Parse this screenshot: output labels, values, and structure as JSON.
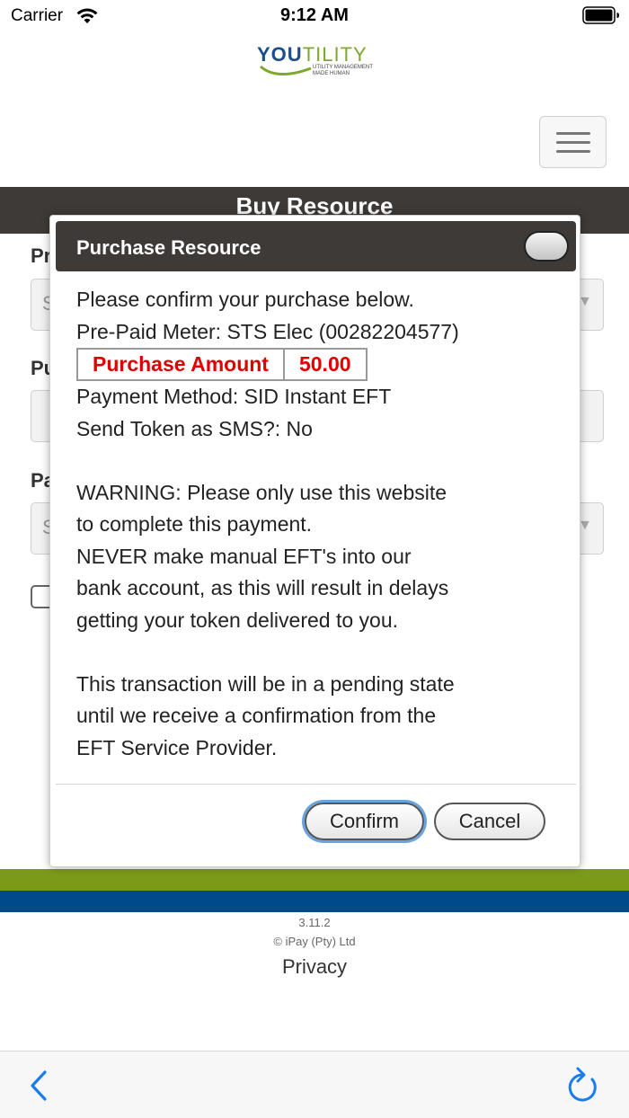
{
  "status_bar": {
    "carrier": "Carrier",
    "time": "9:12 AM"
  },
  "header": {
    "logo_you": "YOU",
    "logo_tility": "TILITY",
    "logo_tag_line1": "UTILITY MANAGEMENT",
    "logo_tag_line2": "MADE HUMAN"
  },
  "page": {
    "title": "Buy Resource",
    "field_label_1": "Pr",
    "field_label_2": "Pu",
    "field_label_3": "Pa",
    "select_placeholder_1": "S",
    "select_placeholder_3": "S"
  },
  "modal": {
    "title": "Purchase Resource",
    "intro": "Please confirm your purchase below.",
    "meter": "Pre-Paid Meter: STS Elec (00282204577)",
    "amount_label": "Purchase Amount",
    "amount_value": "50.00",
    "payment_method": "Payment Method: SID Instant EFT",
    "send_sms": "Send Token as SMS?: No",
    "warning_lines": [
      "WARNING: Please only use this website",
      "to complete this payment.",
      "NEVER make manual EFT's into our",
      "bank account, as this will result in delays",
      "getting your token delivered to you."
    ],
    "pending_lines": [
      "This transaction will be in a pending state",
      "until we receive a confirmation from the",
      "EFT Service Provider."
    ],
    "confirm_label": "Confirm",
    "cancel_label": "Cancel"
  },
  "footer": {
    "version": "3.11.2",
    "copyright": "© iPay (Pty) Ltd",
    "privacy": "Privacy"
  },
  "icons": {
    "wifi": "wifi-icon",
    "battery": "battery-icon",
    "menu": "hamburger-icon",
    "back": "chevron-left-icon",
    "reload": "reload-icon"
  },
  "colors": {
    "header_band": "#3e3a37",
    "amount_text": "#e00000",
    "footer_green": "#7c9a1a",
    "footer_blue": "#004a8c",
    "ios_blue": "#1a7cf2"
  }
}
